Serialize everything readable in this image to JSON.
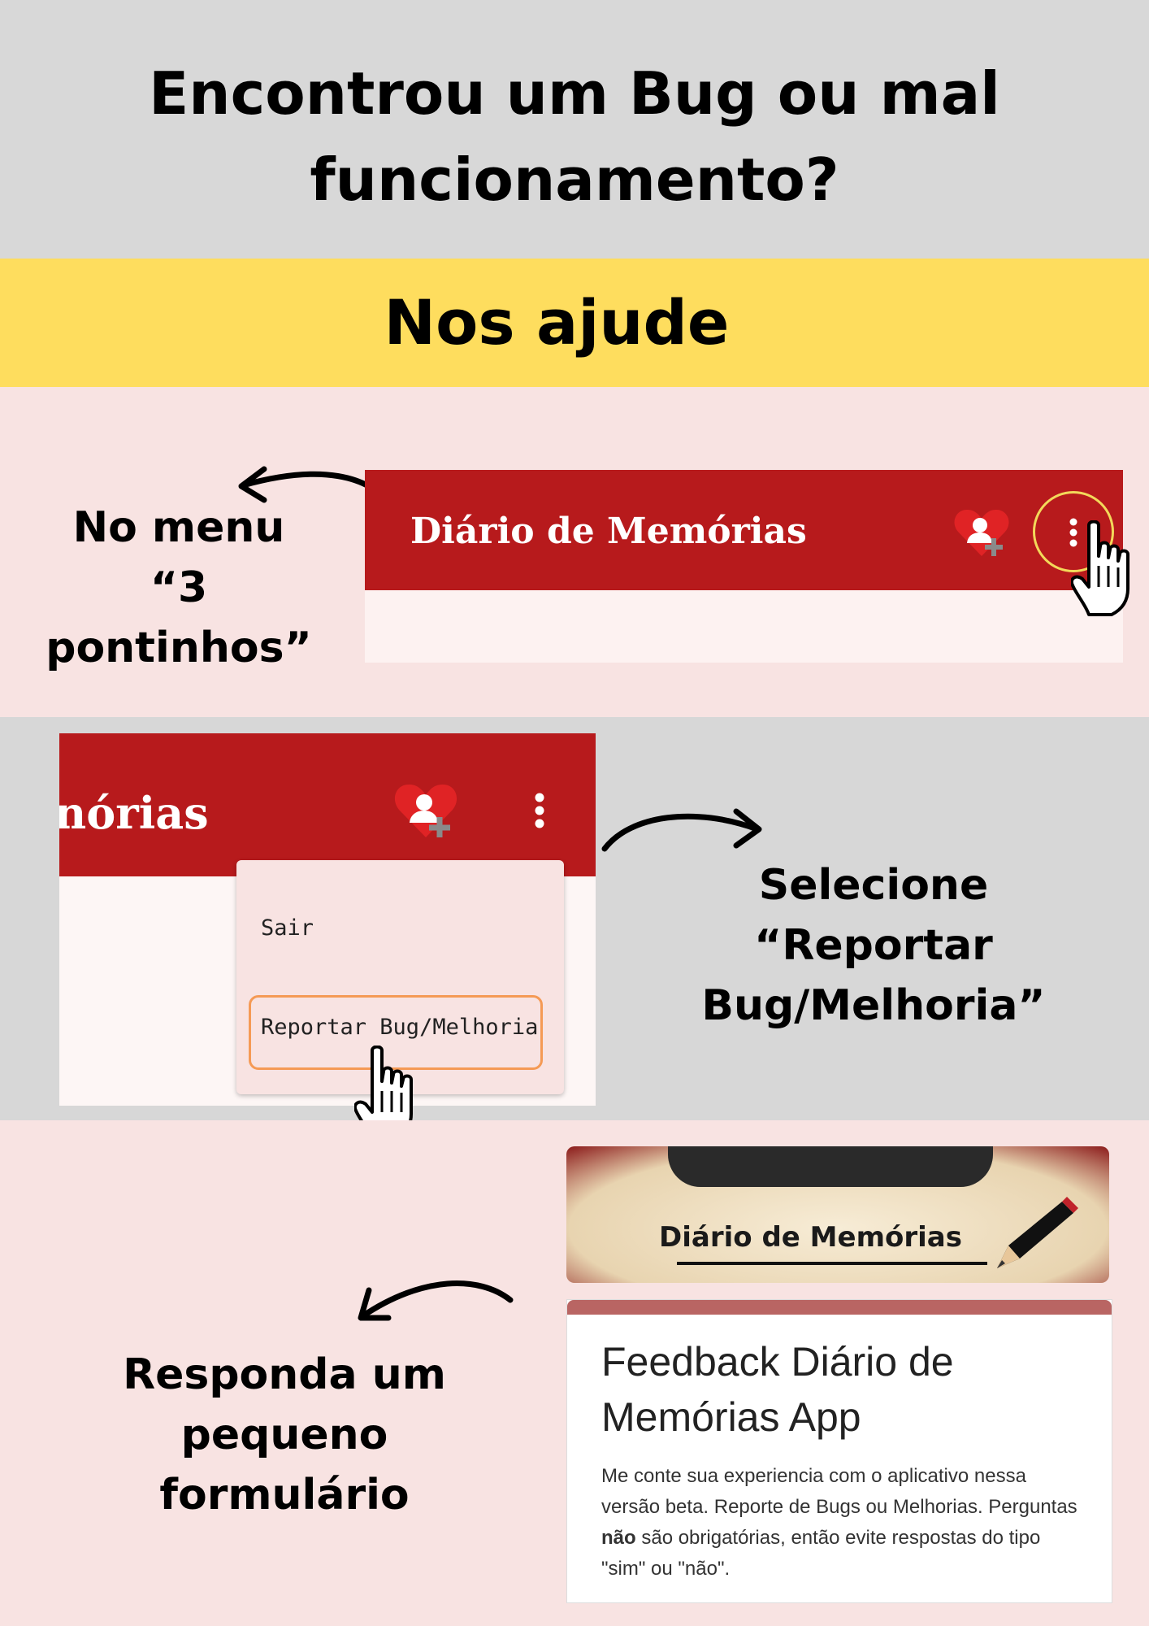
{
  "header": {
    "title_line1": "Encontrou um Bug ou mal",
    "title_line2": "funcionamento?"
  },
  "band": {
    "label": "Nos ajude"
  },
  "step1": {
    "caption_line1": "No menu",
    "caption_line2": "“3 pontinhos”",
    "app_title": "Diário de Memórias"
  },
  "step2": {
    "app_title_partial": "nórias",
    "menu_items": [
      "Sair",
      "Reportar Bug/Melhoria"
    ],
    "caption_line1": "Selecione",
    "caption_line2": "“Reportar Bug/Melhoria”"
  },
  "step3": {
    "caption_line1": "Responda um",
    "caption_line2": "pequeno formulário",
    "banner_title": "Diário de Memórias",
    "form_title": "Feedback Diário de Memórias App",
    "form_desc_1": "Me conte sua experiencia com o aplicativo nessa versão beta. Reporte de Bugs ou Melhorias. Perguntas ",
    "form_desc_bold": "não",
    "form_desc_2": " são obrigatórias, então evite respostas do tipo \"sim\" ou \"não\"."
  },
  "colors": {
    "header_bg": "#d8d8d8",
    "band_bg": "#fedd5e",
    "pink_bg": "#f8e3e2",
    "app_bar": "#b71a1c",
    "highlight": "#f59a55",
    "form_accent": "#b96563"
  }
}
